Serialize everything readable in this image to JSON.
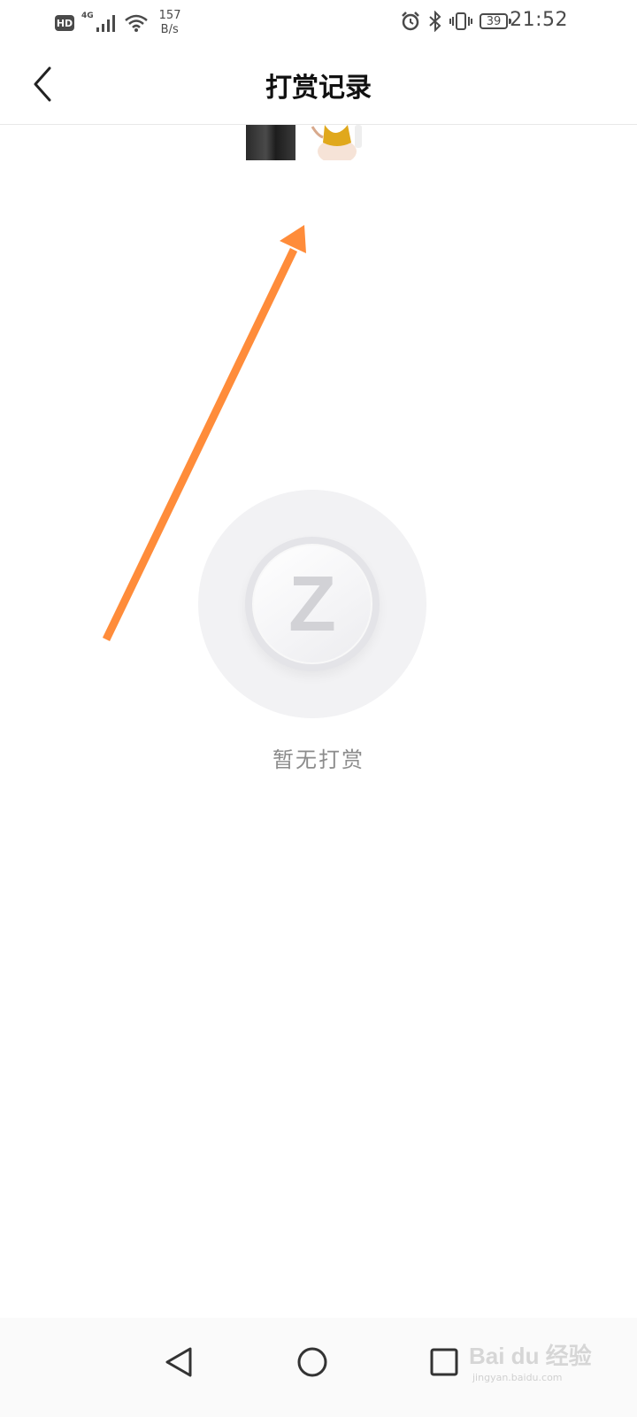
{
  "status_bar": {
    "hd_label": "HD",
    "network_label": "4G",
    "speed_value": "157",
    "speed_unit": "B/s",
    "battery_level": "39",
    "time": "21:52",
    "icons": [
      "signal-icon",
      "wifi-icon",
      "alarm-icon",
      "bluetooth-icon",
      "vibrate-icon",
      "battery-icon"
    ]
  },
  "header": {
    "title": "打赏记录",
    "back_icon": "chevron-left-icon"
  },
  "empty_state": {
    "icon": "coin-z-icon",
    "coin_letter": "Z",
    "message": "暂无打赏"
  },
  "annotation": {
    "arrow_color": "#ff8c3a"
  },
  "nav_bar": {
    "icons": [
      "nav-back-icon",
      "nav-home-icon",
      "nav-recent-icon"
    ]
  },
  "watermark": {
    "logo_text": "Bai du 经验",
    "sub_text": "jingyan.baidu.com"
  }
}
